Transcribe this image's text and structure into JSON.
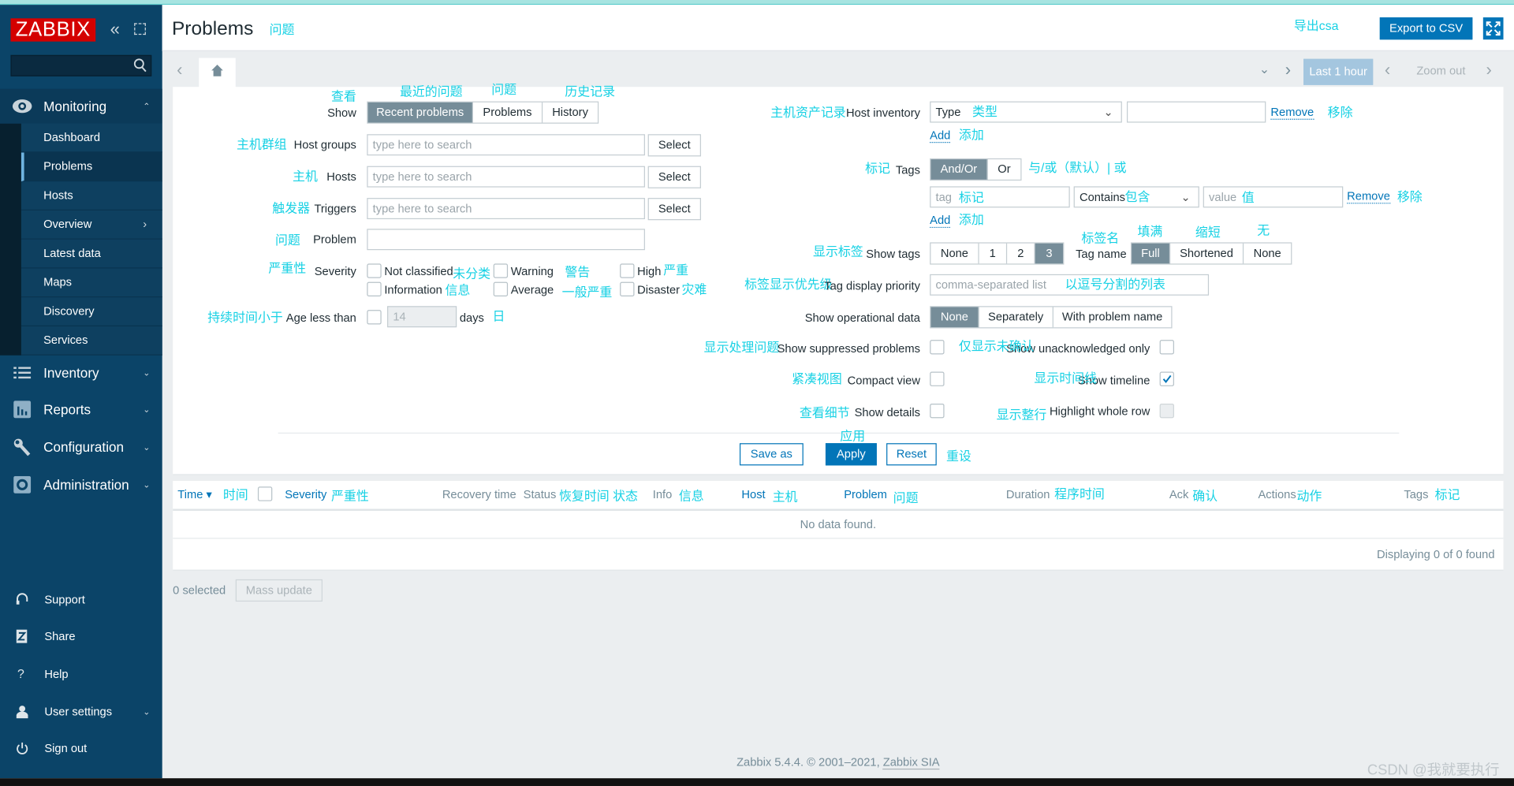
{
  "app": {
    "logo": "ZABBIX",
    "title": "Problems",
    "copyright": "Zabbix 5.4.4. © 2001–2021, ",
    "copyright_link": "Zabbix SIA",
    "watermark": "CSDN @我就要执行"
  },
  "colors": {
    "sidebar": "#0b4468",
    "accent": "#0275b8",
    "annotation": "#17d1e4",
    "logo_bg": "#d40000",
    "selected_segment": "#768d99"
  },
  "sidebar": {
    "search_value": "",
    "monitoring": {
      "label": "Monitoring",
      "icon": "eye-icon",
      "items": [
        "Dashboard",
        "Problems",
        "Hosts",
        "Overview",
        "Latest data",
        "Maps",
        "Discovery",
        "Services"
      ],
      "active": "Problems"
    },
    "sections": [
      {
        "label": "Inventory",
        "icon": "list-icon"
      },
      {
        "label": "Reports",
        "icon": "bar-chart-icon"
      },
      {
        "label": "Configuration",
        "icon": "wrench-icon"
      },
      {
        "label": "Administration",
        "icon": "gear-icon"
      }
    ],
    "footer": [
      {
        "label": "Support",
        "icon": "headset-icon"
      },
      {
        "label": "Share",
        "icon": "share-icon"
      },
      {
        "label": "Help",
        "icon": "help-icon"
      },
      {
        "label": "User settings",
        "icon": "user-icon"
      },
      {
        "label": "Sign out",
        "icon": "power-icon"
      }
    ]
  },
  "header": {
    "export_label": "Export to CSV",
    "time_range": "Last 1 hour",
    "zoom_out": "Zoom out"
  },
  "filter": {
    "show": {
      "label": "Show",
      "options": [
        "Recent problems",
        "Problems",
        "History"
      ],
      "selected": "Recent problems"
    },
    "host_groups": {
      "label": "Host groups",
      "placeholder": "type here to search",
      "button": "Select"
    },
    "hosts": {
      "label": "Hosts",
      "placeholder": "type here to search",
      "button": "Select"
    },
    "triggers": {
      "label": "Triggers",
      "placeholder": "type here to search",
      "button": "Select"
    },
    "problem": {
      "label": "Problem",
      "value": ""
    },
    "severity": {
      "label": "Severity",
      "options": [
        "Not classified",
        "Warning",
        "High",
        "Information",
        "Average",
        "Disaster"
      ]
    },
    "age": {
      "label": "Age less than",
      "value": "14",
      "unit": "days",
      "checked": false
    },
    "host_inventory": {
      "label": "Host inventory",
      "field": "Type",
      "value": "",
      "remove": "Remove",
      "add": "Add"
    },
    "tags": {
      "label": "Tags",
      "options": [
        "And/Or",
        "Or"
      ],
      "selected": "And/Or",
      "tag_placeholder": "tag",
      "operator": "Contains",
      "value_placeholder": "value",
      "remove": "Remove",
      "add": "Add"
    },
    "show_tags": {
      "label": "Show tags",
      "options": [
        "None",
        "1",
        "2",
        "3"
      ],
      "selected": "3"
    },
    "tag_name": {
      "label": "Tag name",
      "options": [
        "Full",
        "Shortened",
        "None"
      ],
      "selected": "Full"
    },
    "tag_priority": {
      "label": "Tag display priority",
      "placeholder": "comma-separated list"
    },
    "operational": {
      "label": "Show operational data",
      "options": [
        "None",
        "Separately",
        "With problem name"
      ],
      "selected": "None"
    },
    "suppressed": {
      "label": "Show suppressed problems",
      "checked": false
    },
    "unack": {
      "label": "Show unacknowledged only",
      "checked": false
    },
    "compact": {
      "label": "Compact view",
      "checked": false
    },
    "timeline": {
      "label": "Show timeline",
      "checked": true
    },
    "details": {
      "label": "Show details",
      "checked": false
    },
    "highlight": {
      "label": "Highlight whole row",
      "checked": false,
      "disabled": true
    },
    "save_as": "Save as",
    "apply": "Apply",
    "reset": "Reset"
  },
  "table": {
    "columns": [
      "Time ▾",
      "Severity",
      "Recovery time",
      "Status",
      "Info",
      "Host",
      "Problem",
      "Duration",
      "Ack",
      "Actions",
      "Tags"
    ],
    "empty": "No data found.",
    "footer": "Displaying 0 of 0 found"
  },
  "bottom": {
    "selected": "0 selected",
    "mass_update": "Mass update"
  },
  "annotations": {
    "title": "问题",
    "export": "导出csa",
    "show": "查看",
    "recent": "最近的问题",
    "problems": "问题",
    "history": "历史记录",
    "host_groups": "主机群组",
    "hosts": "主机",
    "triggers": "触发器",
    "problem": "问题",
    "severity": "严重性",
    "not_classified": "未分类",
    "warning": "警告",
    "high": "严重",
    "information": "信息",
    "average": "一般严重",
    "disaster": "灾难",
    "age": "持续时间小于",
    "days": "日",
    "host_inventory": "主机资产记录",
    "type": "类型",
    "remove1": "移除",
    "add1": "添加",
    "tags": "标记",
    "andor": "与/或（默认）| 或",
    "tag": "标记",
    "contains": "包含",
    "value": "值",
    "remove2": "移除",
    "add2": "添加",
    "show_tags": "显示标签",
    "tag_name": "标签名",
    "full": "填满",
    "shortened": "缩短",
    "none": "无",
    "tag_priority": "标签显示优先级",
    "comma_list": "以逗号分割的列表",
    "suppressed": "显示处理问题",
    "unack": "仅显示未确认",
    "compact": "紧凑视图",
    "timeline": "显示时间线",
    "details": "查看细节",
    "highlight": "显示整行",
    "apply": "应用",
    "reset": "重设",
    "col_time": "时间",
    "col_severity": "严重性",
    "col_recovery_status": "恢复时间 状态",
    "col_info": "信息",
    "col_host": "主机",
    "col_problem": "问题",
    "col_duration": "程序时间",
    "col_ack": "确认",
    "col_actions": "动作",
    "col_tags": "标记"
  }
}
